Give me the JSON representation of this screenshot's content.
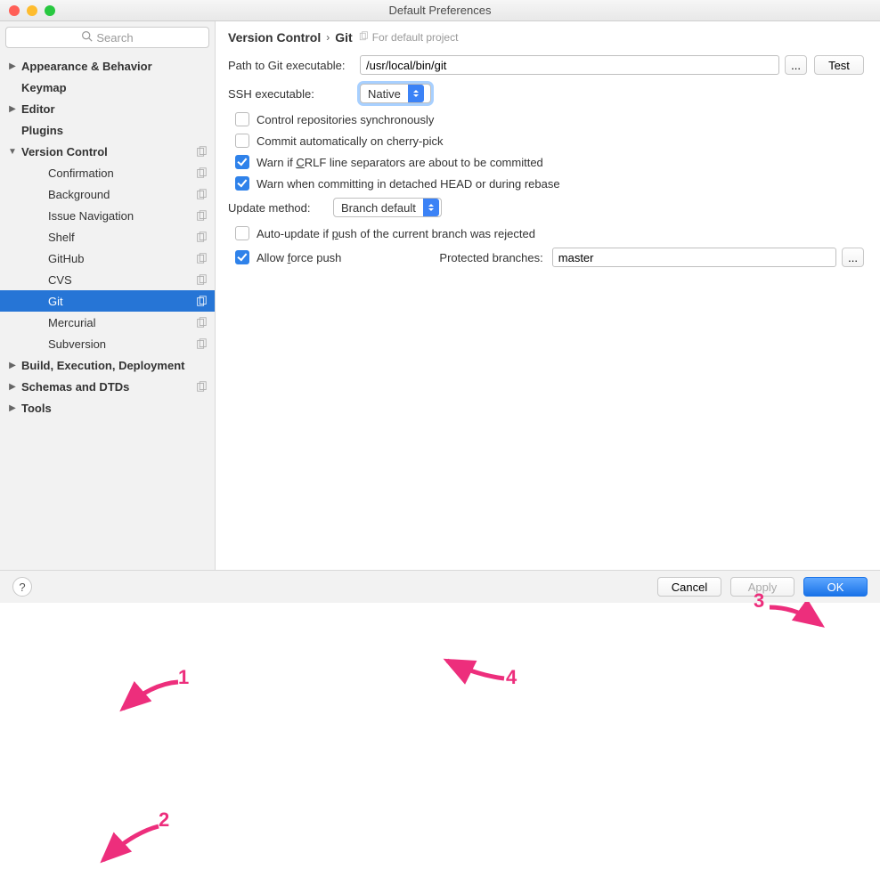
{
  "window": {
    "title": "Default Preferences"
  },
  "search": {
    "placeholder": "Search"
  },
  "sidebar": {
    "items": [
      {
        "label": "Appearance & Behavior",
        "bold": true,
        "expandable": true,
        "expanded": false,
        "copyable": false,
        "level": 0
      },
      {
        "label": "Keymap",
        "bold": true,
        "expandable": false,
        "copyable": false,
        "level": 0
      },
      {
        "label": "Editor",
        "bold": true,
        "expandable": true,
        "expanded": false,
        "copyable": false,
        "level": 0
      },
      {
        "label": "Plugins",
        "bold": true,
        "expandable": false,
        "copyable": false,
        "level": 0
      },
      {
        "label": "Version Control",
        "bold": true,
        "expandable": true,
        "expanded": true,
        "copyable": true,
        "level": 0
      },
      {
        "label": "Confirmation",
        "bold": false,
        "expandable": false,
        "copyable": true,
        "level": 1
      },
      {
        "label": "Background",
        "bold": false,
        "expandable": false,
        "copyable": true,
        "level": 1
      },
      {
        "label": "Issue Navigation",
        "bold": false,
        "expandable": false,
        "copyable": true,
        "level": 1
      },
      {
        "label": "Shelf",
        "bold": false,
        "expandable": false,
        "copyable": true,
        "level": 1
      },
      {
        "label": "GitHub",
        "bold": false,
        "expandable": false,
        "copyable": true,
        "level": 1
      },
      {
        "label": "CVS",
        "bold": false,
        "expandable": false,
        "copyable": true,
        "level": 1
      },
      {
        "label": "Git",
        "bold": false,
        "expandable": false,
        "copyable": true,
        "level": 1,
        "selected": true
      },
      {
        "label": "Mercurial",
        "bold": false,
        "expandable": false,
        "copyable": true,
        "level": 1
      },
      {
        "label": "Subversion",
        "bold": false,
        "expandable": false,
        "copyable": true,
        "level": 1
      },
      {
        "label": "Build, Execution, Deployment",
        "bold": true,
        "expandable": true,
        "expanded": false,
        "copyable": false,
        "level": 0
      },
      {
        "label": "Schemas and DTDs",
        "bold": true,
        "expandable": true,
        "expanded": false,
        "copyable": true,
        "level": 0
      },
      {
        "label": "Tools",
        "bold": true,
        "expandable": true,
        "expanded": false,
        "copyable": false,
        "level": 0
      }
    ]
  },
  "breadcrumb": {
    "parent": "Version Control",
    "current": "Git",
    "note": "For default project"
  },
  "form": {
    "path_label": "Path to Git executable:",
    "path_value": "/usr/local/bin/git",
    "browse_label": "...",
    "test_label": "Test",
    "ssh_label": "SSH executable:",
    "ssh_value": "Native",
    "cb_sync": "Control repositories synchronously",
    "cb_cherry": "Commit automatically on cherry-pick",
    "cb_crlf_pre": "Warn if ",
    "cb_crlf_u": "C",
    "cb_crlf_post": "RLF line separators are about to be committed",
    "cb_detached": "Warn when committing in detached HEAD or during rebase",
    "update_label": "Update method:",
    "update_value": "Branch default",
    "cb_autoupdate_pre": "Auto-update if ",
    "cb_autoupdate_u": "p",
    "cb_autoupdate_post": "ush of the current branch was rejected",
    "cb_force_pre": "Allow ",
    "cb_force_u": "f",
    "cb_force_post": "orce push",
    "protected_label": "Protected branches:",
    "protected_value": "master",
    "protected_more": "..."
  },
  "footer": {
    "cancel": "Cancel",
    "apply": "Apply",
    "ok": "OK"
  },
  "callouts": {
    "n1": "1",
    "n2": "2",
    "n3": "3",
    "n4": "4"
  }
}
